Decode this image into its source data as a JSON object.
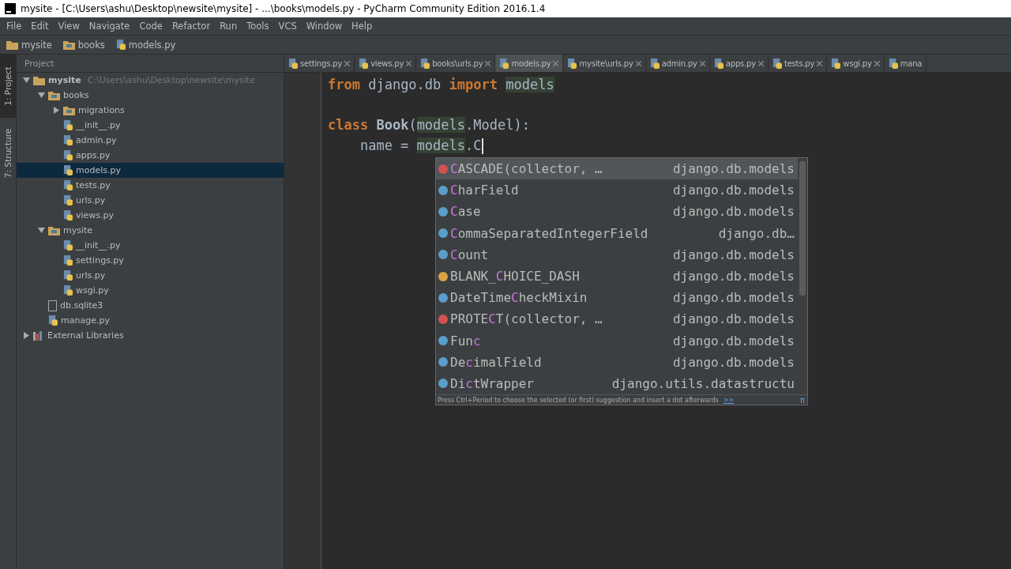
{
  "window": {
    "title": "mysite - [C:\\Users\\ashu\\Desktop\\newsite\\mysite] - ...\\books\\models.py - PyCharm Community Edition 2016.1.4"
  },
  "menu": [
    "File",
    "Edit",
    "View",
    "Navigate",
    "Code",
    "Refactor",
    "Run",
    "Tools",
    "VCS",
    "Window",
    "Help"
  ],
  "breadcrumbs": [
    {
      "label": "mysite",
      "kind": "folder"
    },
    {
      "label": "books",
      "kind": "package"
    },
    {
      "label": "models.py",
      "kind": "python"
    }
  ],
  "side_tabs": [
    {
      "label": "1: Project",
      "selected": true
    },
    {
      "label": "7: Structure",
      "selected": false
    }
  ],
  "project_panel": {
    "title": "Project"
  },
  "tree": [
    {
      "label": "mysite",
      "path": "C:\\Users\\ashu\\Desktop\\newsite\\mysite",
      "kind": "folder",
      "expanded": true,
      "selected": false,
      "children": [
        {
          "label": "books",
          "kind": "package",
          "expanded": true,
          "selected": false,
          "children": [
            {
              "label": "migrations",
              "kind": "package",
              "expanded": false,
              "selected": false
            },
            {
              "label": "__init__.py",
              "kind": "python",
              "selected": false
            },
            {
              "label": "admin.py",
              "kind": "python",
              "selected": false
            },
            {
              "label": "apps.py",
              "kind": "python",
              "selected": false
            },
            {
              "label": "models.py",
              "kind": "python",
              "selected": true
            },
            {
              "label": "tests.py",
              "kind": "python",
              "selected": false
            },
            {
              "label": "urls.py",
              "kind": "python",
              "selected": false
            },
            {
              "label": "views.py",
              "kind": "python",
              "selected": false
            }
          ]
        },
        {
          "label": "mysite",
          "kind": "package",
          "expanded": true,
          "selected": false,
          "children": [
            {
              "label": "__init__.py",
              "kind": "python",
              "selected": false
            },
            {
              "label": "settings.py",
              "kind": "python",
              "selected": false
            },
            {
              "label": "urls.py",
              "kind": "python",
              "selected": false
            },
            {
              "label": "wsgi.py",
              "kind": "python",
              "selected": false
            }
          ]
        },
        {
          "label": "db.sqlite3",
          "kind": "file",
          "selected": false
        },
        {
          "label": "manage.py",
          "kind": "python",
          "selected": false
        }
      ]
    },
    {
      "label": "External Libraries",
      "kind": "library",
      "expanded": false,
      "selected": false
    }
  ],
  "tabs": [
    {
      "label": "settings.py",
      "selected": false,
      "closable": true
    },
    {
      "label": "views.py",
      "selected": false,
      "closable": true
    },
    {
      "label": "books\\urls.py",
      "selected": false,
      "closable": true
    },
    {
      "label": "models.py",
      "selected": true,
      "closable": true
    },
    {
      "label": "mysite\\urls.py",
      "selected": false,
      "closable": true
    },
    {
      "label": "admin.py",
      "selected": false,
      "closable": true
    },
    {
      "label": "apps.py",
      "selected": false,
      "closable": true
    },
    {
      "label": "tests.py",
      "selected": false,
      "closable": true
    },
    {
      "label": "wsgi.py",
      "selected": false,
      "closable": true
    },
    {
      "label": "mana",
      "selected": false,
      "closable": false
    }
  ],
  "code": [
    {
      "gap_before": false,
      "tokens": [
        {
          "kind": "keyword",
          "text": "from"
        },
        {
          "kind": "plain",
          "text": " django.db "
        },
        {
          "kind": "keyword",
          "text": "import "
        },
        {
          "kind": "usage",
          "text": "models"
        }
      ]
    },
    {
      "gap_before": true,
      "tokens": [
        {
          "kind": "keyword",
          "text": "class "
        },
        {
          "kind": "name",
          "text": "Book"
        },
        {
          "kind": "plain",
          "text": "("
        },
        {
          "kind": "usage",
          "text": "models"
        },
        {
          "kind": "plain",
          "text": ".Model):"
        }
      ]
    },
    {
      "gap_before": false,
      "tokens": [
        {
          "kind": "plain",
          "text": "    name = "
        },
        {
          "kind": "usage",
          "text": "models"
        },
        {
          "kind": "plain",
          "text": ".C"
        }
      ]
    }
  ],
  "completion": {
    "items": [
      {
        "kind": "function",
        "match": "C",
        "after": "ASCADE(collector, …",
        "module": "django.db.models",
        "selected": true
      },
      {
        "kind": "class",
        "match": "C",
        "after": "harField",
        "module": "django.db.models",
        "selected": false
      },
      {
        "kind": "class",
        "match": "C",
        "after": "ase",
        "module": "django.db.models",
        "selected": false
      },
      {
        "kind": "class",
        "match": "C",
        "after": "ommaSeparatedIntegerField",
        "module": "django.db…",
        "selected": false
      },
      {
        "kind": "class",
        "match": "C",
        "after": "ount",
        "module": "django.db.models",
        "selected": false
      },
      {
        "kind": "variable",
        "before": "BLANK_",
        "match": "C",
        "after": "HOICE_DASH",
        "module": "django.db.models",
        "selected": false
      },
      {
        "kind": "class",
        "before": "DateTime",
        "match": "C",
        "after": "heckMixin",
        "module": "django.db.models",
        "selected": false
      },
      {
        "kind": "function",
        "before": "PROTE",
        "match": "C",
        "after": "T(collector, …",
        "module": "django.db.models",
        "selected": false
      },
      {
        "kind": "class",
        "before": "Fun",
        "match": "c",
        "module": "django.db.models",
        "selected": false
      },
      {
        "kind": "class",
        "before": "De",
        "match": "c",
        "after": "imalField",
        "module": "django.db.models",
        "selected": false
      },
      {
        "kind": "class",
        "before": "Di",
        "match": "c",
        "after": "tWrapper",
        "module": "django.utils.datastructu",
        "selected": false
      }
    ],
    "hint": "Press Ctrl+Period to choose the selected (or first) suggestion and insert a dot afterwards",
    "hint_link": ">>",
    "corner": "π"
  }
}
